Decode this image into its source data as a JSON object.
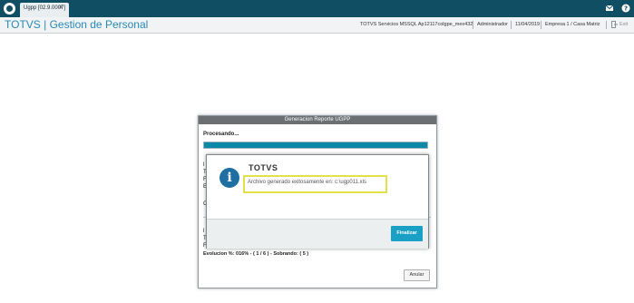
{
  "topbar": {
    "tab_label": "Ugpp [02.9.0007]",
    "tab_close": "×",
    "icons": [
      "logo-icon",
      "mail-icon",
      "help-icon"
    ]
  },
  "header": {
    "app_title": "TOTVS | Gestion de Personal",
    "environment": "TOTVS Servicios MSSQL Ap12117colgpe_mex432",
    "user": "Administrador",
    "date": "11/04/2019",
    "company": "Empresa 1 / Casa Matriz",
    "exit_label": "Exit"
  },
  "dialog": {
    "title": "Generacion Reporte UGPP",
    "processing_label": "Procesando...",
    "progress_fraction": 1.0,
    "fragments": [
      "l",
      "T",
      "F",
      "E",
      "C",
      "l",
      "T",
      "F"
    ],
    "evolution_text": "Evolucion %:  016% - ( 1 / 6 ) - Sobrando: ( 5 )",
    "cancel_label": "Anular"
  },
  "message": {
    "title": "TOTVS",
    "icon": "info-icon",
    "text": "Archivo generado exitosamente en: c:\\ugp011.xls",
    "finish_label": "Finalizar"
  },
  "colors": {
    "topbar": "#0f4e63",
    "accent": "#2a89b3",
    "button": "#1aa0c4",
    "highlight": "#e3e04a"
  }
}
